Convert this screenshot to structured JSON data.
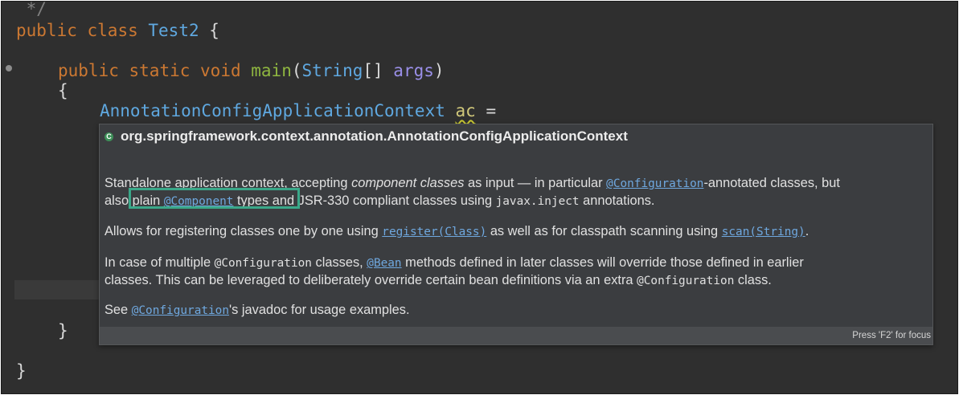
{
  "editor": {
    "line_comment_end": " */",
    "line_class": {
      "kw1": "public",
      "kw2": "class",
      "name": "Test2",
      "brace": "{"
    },
    "line_main": {
      "kw1": "public",
      "kw2": "static",
      "kw3": "void",
      "name": "main",
      "open": "(",
      "type": "String",
      "arr": "[] ",
      "param": "args",
      "close": ")"
    },
    "line_open_brace": "{",
    "line_decl": {
      "type": "AnnotationConfigApplicationContext",
      "var": "ac",
      "eq": " ="
    },
    "line_close_method": "}",
    "line_close_class": "}"
  },
  "popup": {
    "icon_letter": "C",
    "title": "org.springframework.context.annotation.AnnotationConfigApplicationContext",
    "p1": {
      "a": "Standalone application context, accepting ",
      "b": "component classes",
      "c": " as input — in particular ",
      "link1": "@Configuration",
      "d": "-annotated classes, but",
      "e": "also plain ",
      "link2": "@Component",
      "f": " types and JSR-330 compliant classes using ",
      "code": "javax.inject",
      "g": " annotations."
    },
    "p2": {
      "a": "Allows for registering classes one by one using ",
      "link1": "register(Class)",
      "b": " as well as for classpath scanning using ",
      "link2": "scan(String)",
      "c": "."
    },
    "p3": {
      "a": "In case of multiple ",
      "code1": "@Configuration",
      "b": " classes, ",
      "link": "@Bean",
      "c": " methods defined in later classes will override those defined in earlier",
      "d": "classes. This can be leveraged to deliberately override certain bean definitions via an extra ",
      "code2": "@Configuration",
      "e": " class."
    },
    "p4": {
      "a": "See ",
      "link": "@Configuration",
      "b": "'s javadoc for usage examples."
    },
    "footer_hint": "Press 'F2' for focus"
  },
  "colors": {
    "editor_bg": "#2f2f2f",
    "keyword": "#cc7832",
    "class_name": "#5fa8e0",
    "method_name": "#8fb640",
    "param": "#9a8fe8",
    "link": "#6fa8df",
    "highlight_box": "#3aa889"
  }
}
